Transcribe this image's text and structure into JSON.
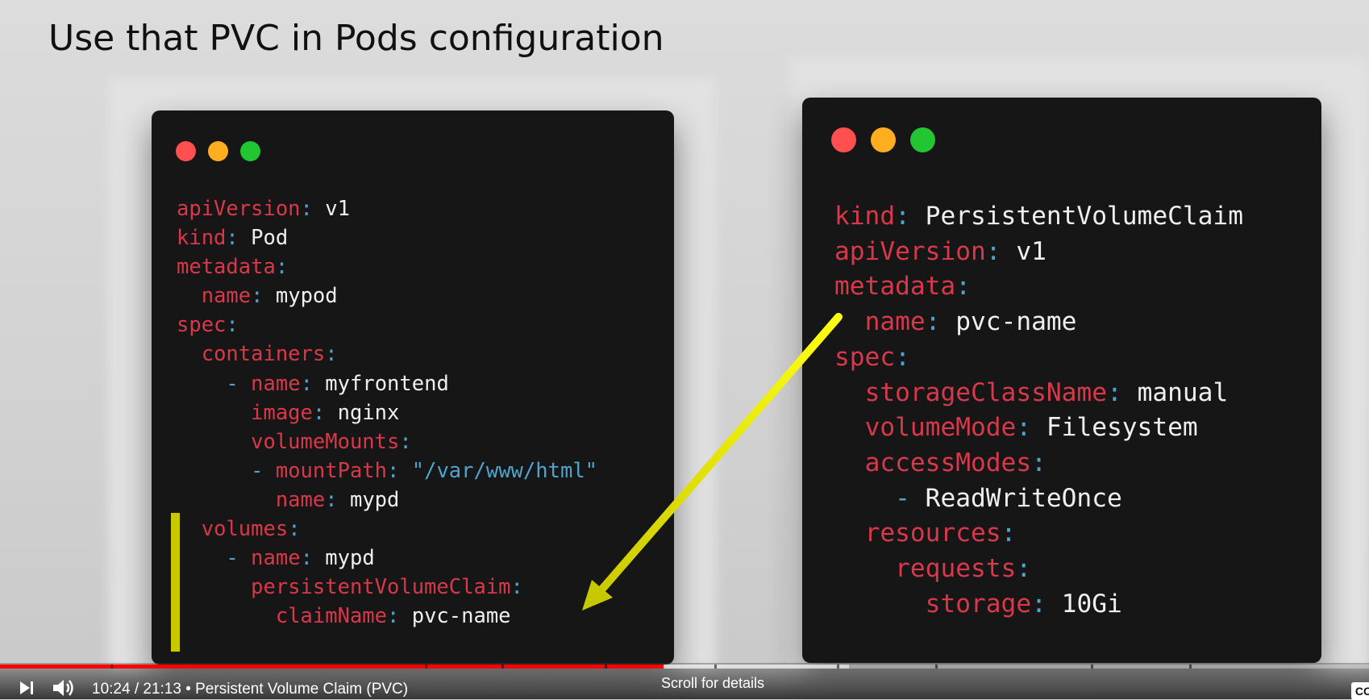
{
  "slide": {
    "title": "Use that PVC in Pods configuration"
  },
  "window_dots": [
    "#ff4f4f",
    "#ffae1f",
    "#22c532"
  ],
  "syntax_colors": {
    "key": "#d8384a",
    "punct": "#4fa3cc",
    "value": "#efefef",
    "string": "#4fa3cc"
  },
  "annotation_color": "#f0f000",
  "pod_yaml": [
    {
      "indent": 0,
      "key": "apiVersion",
      "value": "v1"
    },
    {
      "indent": 0,
      "key": "kind",
      "value": "Pod"
    },
    {
      "indent": 0,
      "key": "metadata",
      "value": ""
    },
    {
      "indent": 1,
      "key": "name",
      "value": "mypod"
    },
    {
      "indent": 0,
      "key": "spec",
      "value": ""
    },
    {
      "indent": 1,
      "key": "containers",
      "value": ""
    },
    {
      "indent": 2,
      "dash": true,
      "key": "name",
      "value": "myfrontend"
    },
    {
      "indent": 3,
      "key": "image",
      "value": "nginx"
    },
    {
      "indent": 3,
      "key": "volumeMounts",
      "value": ""
    },
    {
      "indent": 3,
      "dash": true,
      "key": "mountPath",
      "value": "\"/var/www/html\"",
      "string": true
    },
    {
      "indent": 4,
      "key": "name",
      "value": "mypd"
    },
    {
      "indent": 1,
      "key": "volumes",
      "value": ""
    },
    {
      "indent": 2,
      "dash": true,
      "key": "name",
      "value": "mypd"
    },
    {
      "indent": 3,
      "key": "persistentVolumeClaim",
      "value": ""
    },
    {
      "indent": 4,
      "key": "claimName",
      "value": "pvc-name"
    }
  ],
  "pvc_yaml": [
    {
      "indent": 0,
      "key": "kind",
      "value": "PersistentVolumeClaim"
    },
    {
      "indent": 0,
      "key": "apiVersion",
      "value": "v1"
    },
    {
      "indent": 0,
      "key": "metadata",
      "value": ""
    },
    {
      "indent": 1,
      "key": "name",
      "value": "pvc-name"
    },
    {
      "indent": 0,
      "key": "spec",
      "value": ""
    },
    {
      "indent": 1,
      "key": "storageClassName",
      "value": "manual"
    },
    {
      "indent": 1,
      "key": "volumeMode",
      "value": "Filesystem"
    },
    {
      "indent": 1,
      "key": "accessModes",
      "value": ""
    },
    {
      "indent": 2,
      "dash": true,
      "key": "",
      "value": "ReadWriteOnce"
    },
    {
      "indent": 1,
      "key": "resources",
      "value": ""
    },
    {
      "indent": 2,
      "key": "requests",
      "value": ""
    },
    {
      "indent": 3,
      "key": "storage",
      "value": "10Gi"
    }
  ],
  "player": {
    "played_fraction": 0.4848,
    "buffered_fraction": 0.62,
    "time_text": "10:24 / 21:13 • Persistent Volume Claim (PVC)",
    "scroll_hint": "Scroll for details",
    "cc_label": "CC",
    "icons": {
      "next": "next-track-icon",
      "volume": "volume-icon"
    }
  }
}
